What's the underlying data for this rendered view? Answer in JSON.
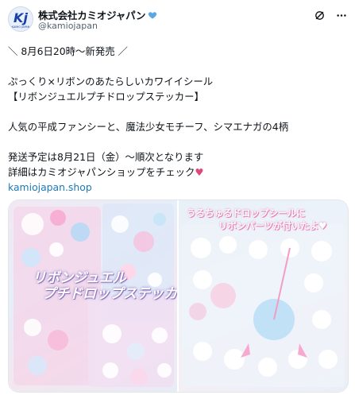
{
  "post": {
    "author": {
      "display_name": "株式会社カミオジャパン",
      "handle": "@kamiojapan",
      "avatar_logo_text": "Kj",
      "avatar_logo_sub": "KAMIO JAPAN"
    },
    "text_lines": [
      "＼ 8月6日20時〜新発売 ／",
      "",
      "ぷっくり×リボンのあたらしいカワイイシール",
      "【リボンジュエルプチドロップステッカー】",
      "",
      "人気の平成ファンシーと、魔法少女モチーフ、シマエナガの4柄",
      "",
      "発送予定は8月21日（金）〜順次となります",
      "詳細はカミオジャパンショップをチェック"
    ],
    "heart_glyph": "♥",
    "link_text": "kamiojapan.shop",
    "media": {
      "left_overlay_line1": "リボンジュエル",
      "left_overlay_line2": "プチドロップステッカー",
      "right_overlay_line1": "うるちゅるドロップシールに",
      "right_overlay_line2": "リボンパーツが付いたよ♥"
    }
  },
  "icons": [
    "verified-heart-icon",
    "grok-icon",
    "more-icon"
  ],
  "colors": {
    "link": "#1d7ab8",
    "heart": "#e0457b",
    "verified": "#5aa7e6",
    "handle": "#536471"
  }
}
